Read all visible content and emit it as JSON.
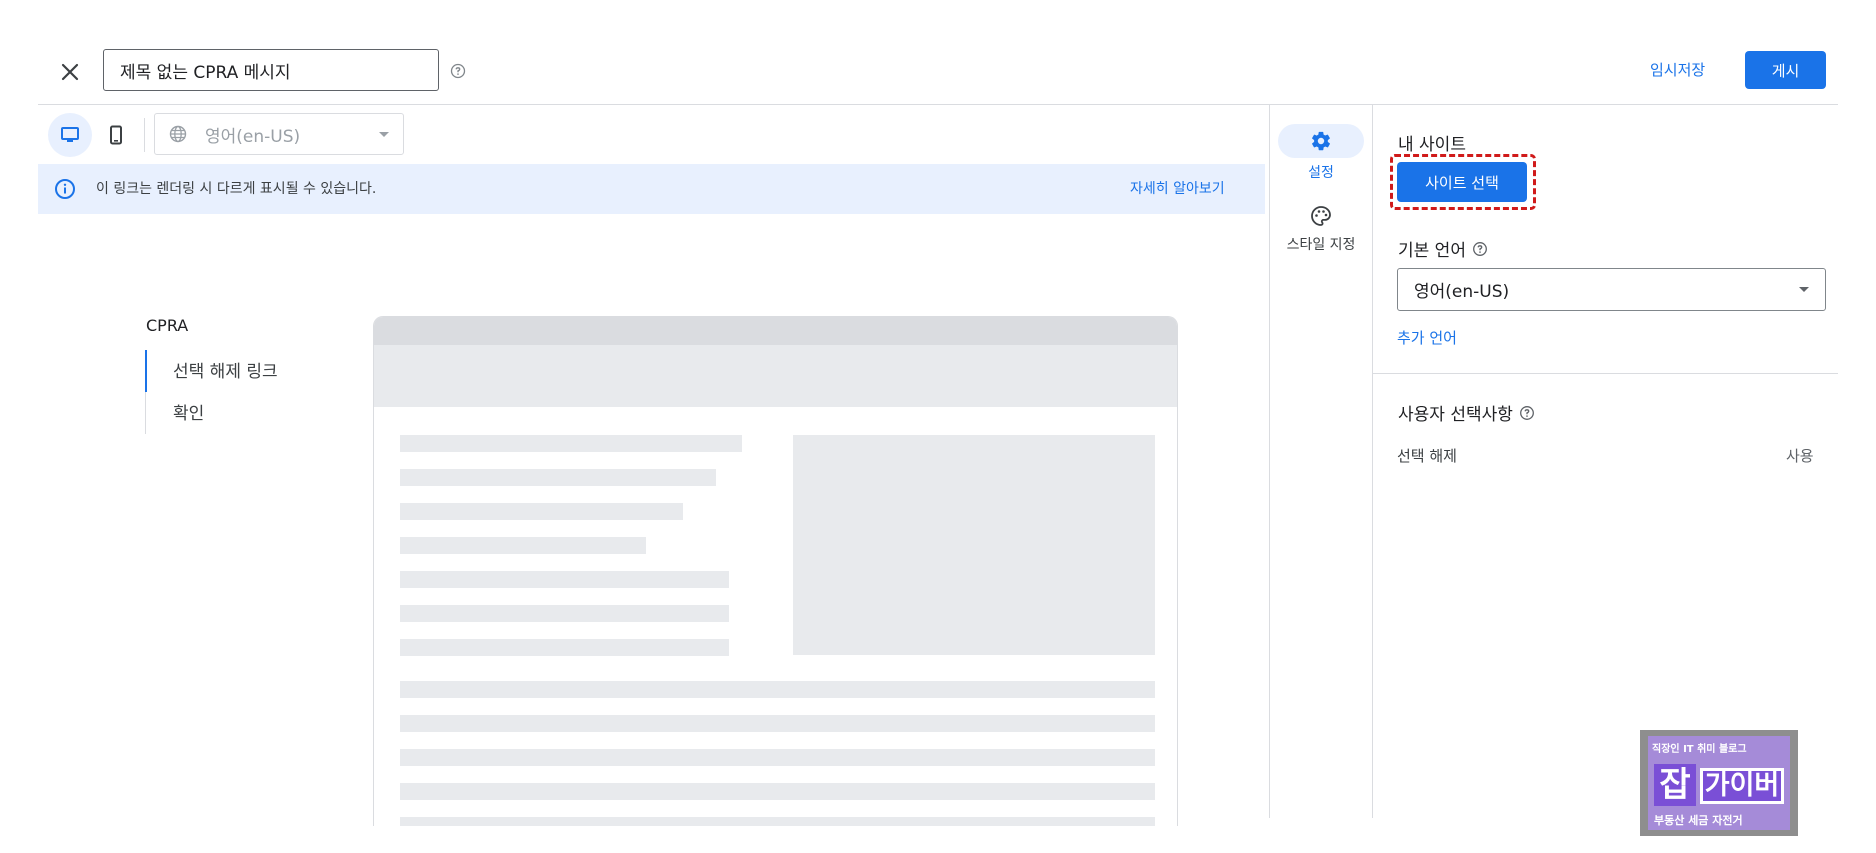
{
  "header": {
    "title_value": "제목 없는 CPRA 메시지",
    "save_draft_label": "임시저장",
    "publish_label": "게시"
  },
  "toolbar": {
    "language_value": "영어(en-US)"
  },
  "banner": {
    "text": "이 링크는 렌더링 시 다르게 표시될 수 있습니다.",
    "link_label": "자세히 알아보기"
  },
  "nav": {
    "section": "CPRA",
    "items": [
      {
        "label": "선택 해제 링크",
        "active": true
      },
      {
        "label": "확인",
        "active": false
      }
    ]
  },
  "side_tabs": [
    {
      "label": "설정",
      "icon": "gear-icon",
      "active": true
    },
    {
      "label": "스타일 지정",
      "icon": "palette-icon",
      "active": false
    }
  ],
  "right_panel": {
    "my_sites_label": "내 사이트",
    "select_site_button": "사이트 선택",
    "default_language_label": "기본 언어",
    "default_language_value": "영어(en-US)",
    "add_language_label": "추가 언어",
    "user_choices_label": "사용자 선택사항",
    "choice_row": {
      "label": "선택 해제",
      "value": "사용"
    }
  },
  "watermark": {
    "top_text": "직장인 IT 취미 블로그",
    "char1": "잡",
    "word": "가이버",
    "bottom_text": "부동산 세금 자전거"
  },
  "colors": {
    "accent": "#1a73e8",
    "highlight_border": "#d01a1a",
    "banner_bg": "#e8f0fe"
  }
}
